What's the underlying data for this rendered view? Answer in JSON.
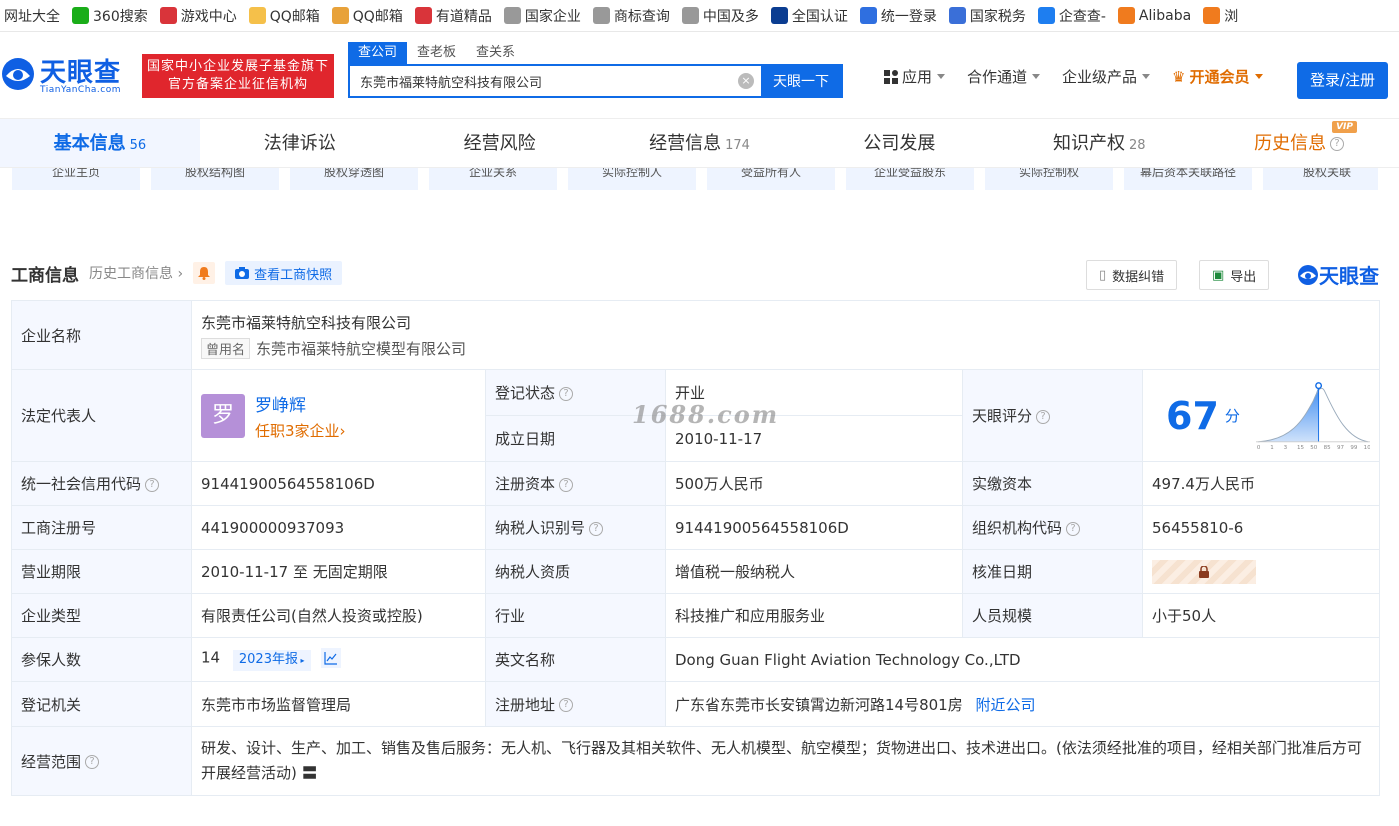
{
  "bookmarks": [
    {
      "label": "网址大全",
      "color": "#ffffff"
    },
    {
      "label": "360搜索",
      "color": "#1aad19"
    },
    {
      "label": "游戏中心",
      "color": "#d9343a"
    },
    {
      "label": "QQ邮箱",
      "color": "#f5c04a"
    },
    {
      "label": "QQ邮箱",
      "color": "#e8a23a"
    },
    {
      "label": "有道精品",
      "color": "#d9343a"
    },
    {
      "label": "国家企业",
      "color": "#999999"
    },
    {
      "label": "商标查询",
      "color": "#999999"
    },
    {
      "label": "中国及多",
      "color": "#999999"
    },
    {
      "label": "全国认证",
      "color": "#0b3d91"
    },
    {
      "label": "统一登录",
      "color": "#2f6fe0"
    },
    {
      "label": "国家税务",
      "color": "#3a6fd8"
    },
    {
      "label": "企查查-",
      "color": "#1e7ef0"
    },
    {
      "label": "Alibaba",
      "color": "#f07b1e"
    },
    {
      "label": "浏",
      "color": "#f07b1e"
    }
  ],
  "header": {
    "logo_text": "天眼查",
    "logo_sub": "TianYanCha.com",
    "badge_line1": "国家中小企业发展子基金旗下",
    "badge_line2": "官方备案企业征信机构",
    "search_tabs": [
      "查公司",
      "查老板",
      "查关系"
    ],
    "search_value": "东莞市福莱特航空科技有限公司",
    "search_button": "天眼一下",
    "nav": [
      "应用",
      "合作通道",
      "企业级产品"
    ],
    "vip_label": "开通会员",
    "login_label": "登录/注册"
  },
  "main_tabs": [
    {
      "label": "基本信息",
      "count": "56"
    },
    {
      "label": "法律诉讼",
      "count": ""
    },
    {
      "label": "经营风险",
      "count": ""
    },
    {
      "label": "经营信息",
      "count": "174"
    },
    {
      "label": "公司发展",
      "count": ""
    },
    {
      "label": "知识产权",
      "count": "28"
    },
    {
      "label": "历史信息",
      "count": ""
    }
  ],
  "vip_tag": "VIP",
  "sub_tabs": [
    "企业主页",
    "股权结构图",
    "股权穿透图",
    "企业关系",
    "实际控制人",
    "受益所有人",
    "企业受益股东",
    "实际控制权",
    "幕后资本关联路径",
    "股权关联"
  ],
  "section": {
    "title": "工商信息",
    "history_link": "历史工商信息",
    "snapshot_label": "查看工商快照",
    "correct_label": "数据纠错",
    "export_label": "导出",
    "brand": "天眼查"
  },
  "info": {
    "company_name_label": "企业名称",
    "company_name": "东莞市福莱特航空科技有限公司",
    "used_name_tag": "曾用名",
    "used_name": "东莞市福莱特航空模型有限公司",
    "legal_rep_label": "法定代表人",
    "legal_rep_avatar": "罗",
    "legal_rep_name": "罗峥辉",
    "legal_rep_sub": "任职3家企业",
    "reg_status_label": "登记状态",
    "reg_status": "开业",
    "found_date_label": "成立日期",
    "found_date": "2010-11-17",
    "score_label": "天眼评分",
    "score": "67",
    "score_unit": "分",
    "score_ticks": [
      "0",
      "1",
      "3",
      "15",
      "50",
      "85",
      "97",
      "99",
      "100"
    ],
    "credit_code_label": "统一社会信用代码",
    "credit_code": "91441900564558106D",
    "reg_capital_label": "注册资本",
    "reg_capital": "500万人民币",
    "paid_capital_label": "实缴资本",
    "paid_capital": "497.4万人民币",
    "biz_reg_no_label": "工商注册号",
    "biz_reg_no": "441900000937093",
    "taxpayer_id_label": "纳税人识别号",
    "taxpayer_id": "91441900564558106D",
    "org_code_label": "组织机构代码",
    "org_code": "56455810-6",
    "biz_term_label": "营业期限",
    "biz_term": "2010-11-17 至 无固定期限",
    "taxpayer_qual_label": "纳税人资质",
    "taxpayer_qual": "增值税一般纳税人",
    "approve_date_label": "核准日期",
    "company_type_label": "企业类型",
    "company_type": "有限责任公司(自然人投资或控股)",
    "industry_label": "行业",
    "industry": "科技推广和应用服务业",
    "staff_size_label": "人员规模",
    "staff_size": "小于50人",
    "insured_label": "参保人数",
    "insured": "14",
    "insured_year": "2023年报",
    "english_name_label": "英文名称",
    "english_name": "Dong Guan Flight Aviation Technology Co.,LTD",
    "authority_label": "登记机关",
    "authority": "东莞市市场监督管理局",
    "address_label": "注册地址",
    "address": "广东省东莞市长安镇霄边新河路14号801房",
    "nearby_label": "附近公司",
    "scope_label": "经营范围",
    "scope": "研发、设计、生产、加工、销售及售后服务：无人机、飞行器及其相关软件、无人机模型、航空模型；货物进出口、技术进出口。(依法须经批准的项目，经相关部门批准后方可开展经营活动)"
  },
  "watermark": "1688.com",
  "colors": {
    "brand_blue": "#0f6be6",
    "vip_orange": "#e06c00",
    "status_green": "#2a9d3f",
    "badge_red": "#e0262d"
  }
}
